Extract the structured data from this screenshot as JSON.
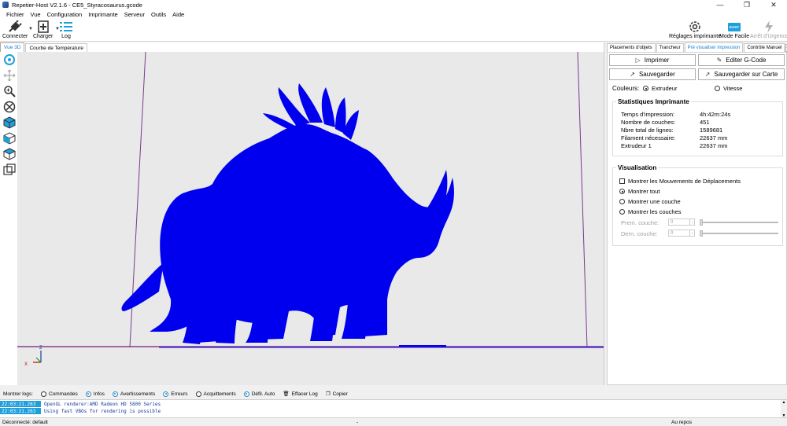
{
  "window": {
    "title": "Repetier-Host V2.1.6 - CE5_Styracosaurus.gcode"
  },
  "menu": [
    "Fichier",
    "Vue",
    "Configuration",
    "Imprimante",
    "Serveur",
    "Outils",
    "Aide"
  ],
  "toolbar": {
    "connect_label": "Connecter",
    "load_label": "Charger",
    "log_label": "Log",
    "printer_settings_label": "Réglages imprimante",
    "easy_mode_label": "Mode Facile",
    "easy_badge": "EASY",
    "emergency_label": "Arrêt d'Urgence"
  },
  "left_tabs": [
    "Vue 3D",
    "Courbe de Température"
  ],
  "right_tabs": [
    "Placements d'objets",
    "Trancheur",
    "Pré visualiser impression",
    "Contrôle Manuel"
  ],
  "preview": {
    "print_button": "Imprimer",
    "edit_gcode_button": "Editer G-Code",
    "save_button": "Sauvegarder",
    "save_card_button": "Sauvegarder sur Carte",
    "colors_label": "Couleurs:",
    "color_extruder": "Extrudeur",
    "color_speed": "Vitesse",
    "stats_title": "Statistiques Imprimante",
    "stats": [
      {
        "label": "Temps d'impression:",
        "value": "4h:42m:24s"
      },
      {
        "label": "Nombre de couches:",
        "value": "451"
      },
      {
        "label": "Nbre total de lignes:",
        "value": "1589681"
      },
      {
        "label": "Filament nécessaire:",
        "value": "22637 mm"
      },
      {
        "label": "Extrudeur 1",
        "value": "22637 mm"
      }
    ],
    "vis_title": "Visualisation",
    "show_travel": "Montrer les Mouvements de Déplacements",
    "show_all": "Montrer tout",
    "show_one": "Montrer une couche",
    "show_layers": "Montrer les couches",
    "first_layer": "Prem. couche:",
    "last_layer": "Dern. couche:",
    "first_layer_value": "0",
    "last_layer_value": "0"
  },
  "axis": {
    "z": "Z",
    "x": "X"
  },
  "logbar": {
    "label": "Montrer logs:",
    "commands": "Commandes",
    "infos": "Infos",
    "warnings": "Avertissements",
    "errors": "Erreurs",
    "acks": "Acquittements",
    "autoscroll": "Défil. Auto",
    "clear": "Effacer Log",
    "copy": "Copier"
  },
  "log": [
    {
      "time": "22:03:21.263",
      "message": "OpenGL renderer:AMD Radeon HD 5800 Series"
    },
    {
      "time": "22:03:21.263",
      "message": "Using fast VBOs for rendering is possible"
    }
  ],
  "status": {
    "connection": "Déconnecté: default",
    "middle": "-",
    "state": "Au repos"
  },
  "colors": {
    "model": "#0000ee",
    "accent": "#1ea0dc",
    "viewport": "#e9e9e9"
  }
}
